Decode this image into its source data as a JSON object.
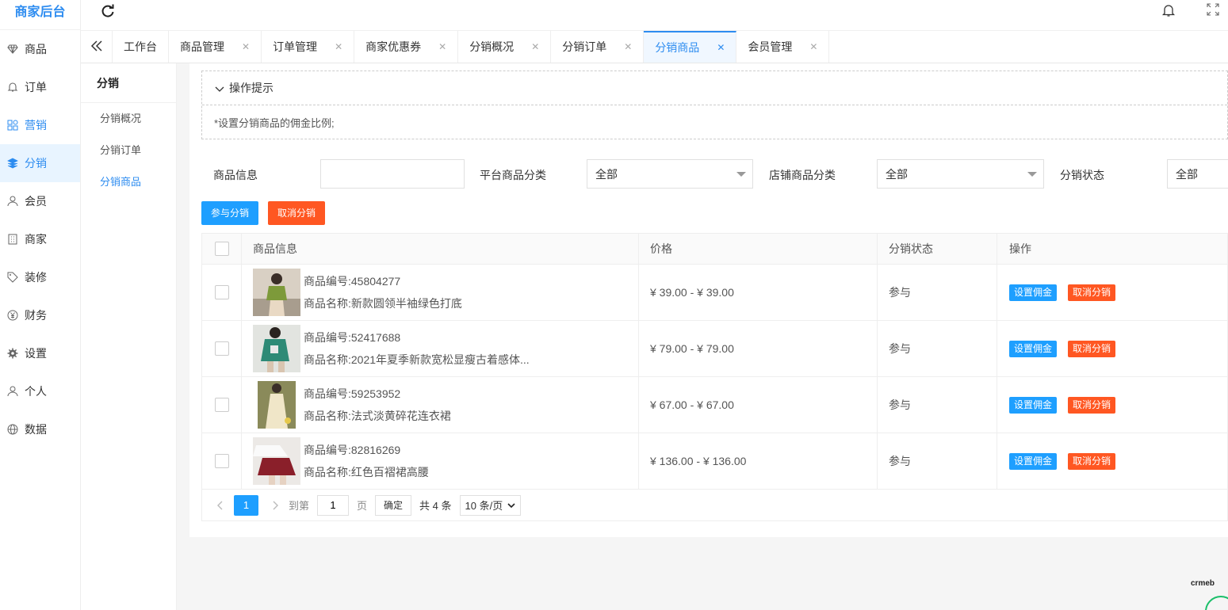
{
  "app": {
    "title": "商家后台"
  },
  "sidebar": {
    "items": [
      {
        "label": "商品",
        "icon": "diamond-icon"
      },
      {
        "label": "订单",
        "icon": "bell-icon"
      },
      {
        "label": "营销",
        "icon": "grid-icon"
      },
      {
        "label": "分销",
        "icon": "layers-icon"
      },
      {
        "label": "会员",
        "icon": "user-icon"
      },
      {
        "label": "商家",
        "icon": "building-icon"
      },
      {
        "label": "装修",
        "icon": "tag-icon"
      },
      {
        "label": "财务",
        "icon": "yen-icon"
      },
      {
        "label": "设置",
        "icon": "gear-icon"
      },
      {
        "label": "个人",
        "icon": "person-icon"
      },
      {
        "label": "数据",
        "icon": "globe-icon"
      }
    ]
  },
  "tabs": [
    {
      "label": "工作台"
    },
    {
      "label": "商品管理"
    },
    {
      "label": "订单管理"
    },
    {
      "label": "商家优惠券"
    },
    {
      "label": "分销概况"
    },
    {
      "label": "分销订单"
    },
    {
      "label": "分销商品"
    },
    {
      "label": "会员管理"
    }
  ],
  "submenu": {
    "title": "分销",
    "items": [
      {
        "label": "分销概况"
      },
      {
        "label": "分销订单"
      },
      {
        "label": "分销商品"
      }
    ]
  },
  "tips": {
    "title": "操作提示",
    "body": "*设置分销商品的佣金比例;"
  },
  "filters": {
    "product_info_label": "商品信息",
    "product_info_value": "",
    "platform_category_label": "平台商品分类",
    "platform_category_value": "全部",
    "shop_category_label": "店铺商品分类",
    "shop_category_value": "全部",
    "status_label": "分销状态",
    "status_value": "全部"
  },
  "actions": {
    "join_label": "参与分销",
    "cancel_label": "取消分销"
  },
  "table": {
    "headers": {
      "info": "商品信息",
      "price": "价格",
      "status": "分销状态",
      "ops": "操作"
    },
    "rows": [
      {
        "code": "商品编号:45804277",
        "name": "商品名称:新款圆领半袖绿色打底",
        "price": "¥ 39.00 - ¥ 39.00",
        "status": "参与",
        "set_label": "设置佣金",
        "cancel_label": "取消分销"
      },
      {
        "code": "商品编号:52417688",
        "name": "商品名称:2021年夏季新款宽松显瘦古着感体...",
        "price": "¥ 79.00 - ¥ 79.00",
        "status": "参与",
        "set_label": "设置佣金",
        "cancel_label": "取消分销"
      },
      {
        "code": "商品编号:59253952",
        "name": "商品名称:法式淡黄碎花连衣裙",
        "price": "¥ 67.00 - ¥ 67.00",
        "status": "参与",
        "set_label": "设置佣金",
        "cancel_label": "取消分销"
      },
      {
        "code": "商品编号:82816269",
        "name": "商品名称:红色百褶裙高腰",
        "price": "¥ 136.00 - ¥ 136.00",
        "status": "参与",
        "set_label": "设置佣金",
        "cancel_label": "取消分销"
      }
    ]
  },
  "pagination": {
    "current_page": "1",
    "goto_label": "到第",
    "goto_value": "1",
    "page_unit": "页",
    "confirm_label": "确定",
    "total_label": "共 4 条",
    "page_size": "10 条/页"
  },
  "watermark": "crmeb",
  "colors": {
    "primary": "#1e9fff",
    "accent_blue": "#2d8cf0",
    "danger": "#ff5722"
  }
}
